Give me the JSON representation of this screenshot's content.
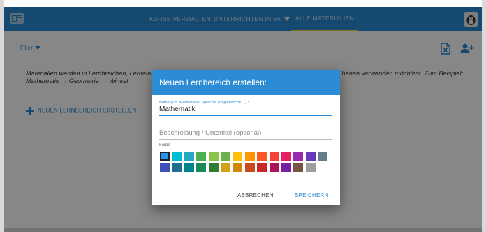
{
  "nav": {
    "items": [
      {
        "label": "KURSE VERWALTEN"
      },
      {
        "label": "UNTERRICHTEN IN 6A"
      },
      {
        "label": "ALLE MATERIALIEN"
      }
    ]
  },
  "page": {
    "filter_label": "Filter",
    "info_text": "Materialien werden in Lernbreichen, Lerneinheiten und Materialien organisiert. Überlege dir, wie du diese drei Ebenen verwenden möchtest. Zum Beispiel: Mathematik → Geometrie → Winkel",
    "add_label": "NEUEN LERNBEREICH ERSTELLEN"
  },
  "dialog": {
    "title": "Neuen Lernbereich erstellen:",
    "name_label": "Name (z.B. Mathematik, Sprache, Projektwoche ...) *",
    "name_value": "Mathematik",
    "description_placeholder": "Beschreibung / Untertitel (optional)",
    "color_label": "Farbe",
    "colors_row1": [
      "#2196f3",
      "#00bcd4",
      "#26a8c0",
      "#4caf50",
      "#8bc34a",
      "#6bb24a",
      "#ffc107",
      "#ff9800",
      "#ff5722",
      "#f44336",
      "#e91e63",
      "#9c27b0",
      "#673ab7",
      "#607d8b"
    ],
    "colors_row2": [
      "#3f51b5",
      "#1e6e8e",
      "#00838f",
      "#1b8a5a",
      "#2e7d32",
      "#d4a017",
      "#d4860b",
      "#c84b1e",
      "#c62828",
      "#ad1457",
      "#7b1fa2",
      "#795548",
      "#9e9e9e"
    ],
    "selected_color_index": 0,
    "cancel_label": "ABBRECHEN",
    "save_label": "SPEICHERN"
  },
  "theme": {
    "primary": "#2b8bd4",
    "accent_underline": "#ffd43b"
  }
}
